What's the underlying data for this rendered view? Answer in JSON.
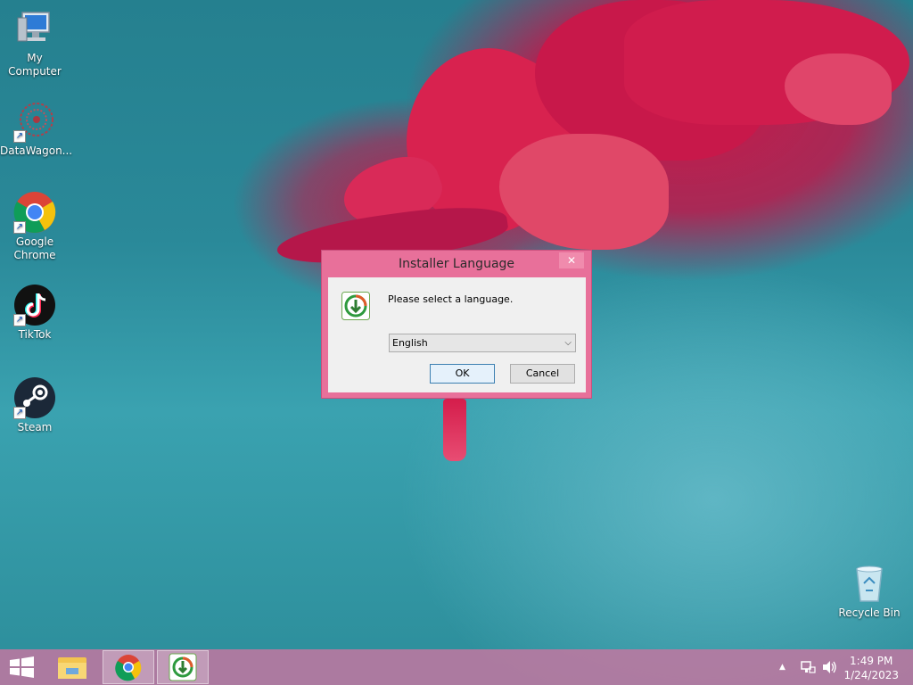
{
  "desktop": {
    "icons": [
      {
        "label": "My Computer"
      },
      {
        "label": "DataWagon..."
      },
      {
        "label": "Google Chrome"
      },
      {
        "label": "TikTok"
      },
      {
        "label": "Steam"
      },
      {
        "label": "Recycle Bin"
      }
    ]
  },
  "dialog": {
    "title": "Installer Language",
    "close_label": "✕",
    "message": "Please select a language.",
    "language_selected": "English",
    "ok_label": "OK",
    "cancel_label": "Cancel"
  },
  "taskbar": {
    "items": [
      "start-icon",
      "file-explorer-icon",
      "chrome-icon",
      "installer-icon"
    ],
    "tray": {
      "time": "1:49 PM",
      "date": "1/24/2023"
    }
  },
  "colors": {
    "dialog_frame": "#e8709a",
    "taskbar": "#be78a0",
    "wallpaper_teal": "#2a8999",
    "flower_red": "#d8224f"
  }
}
